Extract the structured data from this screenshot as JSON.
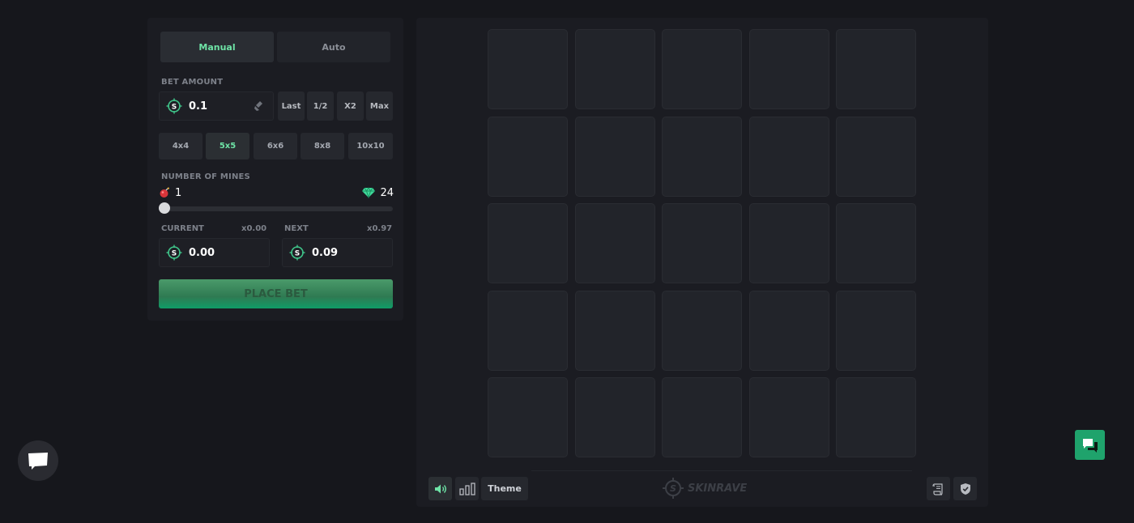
{
  "mode": {
    "manual": "Manual",
    "auto": "Auto",
    "active": "manual"
  },
  "bet": {
    "label": "BET AMOUNT",
    "value": "0.1",
    "quick": {
      "last": "Last",
      "half": "1/2",
      "double": "X2",
      "max": "Max"
    }
  },
  "grid_sizes": {
    "s4": "4x4",
    "s5": "5x5",
    "s6": "6x6",
    "s8": "8x8",
    "s10": "10x10",
    "active": "5x5"
  },
  "mines": {
    "label": "NUMBER OF MINES",
    "count": "1",
    "gems": "24",
    "slider_fraction": 0.0
  },
  "current": {
    "label": "CURRENT",
    "multiplier": "x0.00",
    "value": "0.00"
  },
  "next": {
    "label": "NEXT",
    "multiplier": "x0.97",
    "value": "0.09"
  },
  "place_bet": "PLACE BET",
  "board": {
    "rows": 5,
    "cols": 5
  },
  "footer": {
    "theme": "Theme",
    "brand": "SKINRAVE"
  },
  "colors": {
    "accent": "#6ee3a6",
    "button_green": "#1fa36c",
    "background": "#16171c",
    "panel": "#1b1c22"
  },
  "icons": {
    "coin": "skinrave-coin-icon",
    "broom": "clear-icon",
    "mine": "bomb-icon",
    "gem": "diamond-icon",
    "sound": "speaker-icon",
    "stats": "bar-chart-icon",
    "history": "scroll-icon",
    "fair": "shield-icon",
    "chat": "chat-bubble-icon",
    "support": "support-chat-icon"
  }
}
